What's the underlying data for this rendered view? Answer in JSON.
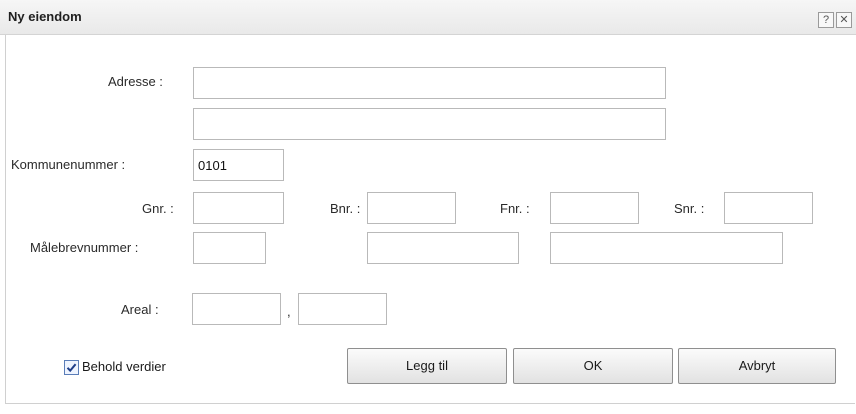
{
  "dialog": {
    "title": "Ny eiendom",
    "help_glyph": "?",
    "close_glyph": "✕"
  },
  "form": {
    "address_label": "Adresse :",
    "address_line1_value": "",
    "address_line2_value": "",
    "kommunenummer_label": "Kommunenummer :",
    "kommunenummer_value": "0101",
    "gnr_label": "Gnr. :",
    "gnr_value": "",
    "bnr_label": "Bnr. :",
    "bnr_value": "",
    "fnr_label": "Fnr. :",
    "fnr_value": "",
    "snr_label": "Snr. :",
    "snr_value": "",
    "malebrev_label": "Målebrevnummer :",
    "malebrev_value1": "",
    "malebrev_value2": "",
    "malebrev_value3": "",
    "areal_label": "Areal :",
    "areal_whole_value": "",
    "areal_separator": ",",
    "areal_fraction_value": ""
  },
  "footer": {
    "keep_values_label": "Behold verdier",
    "keep_values_checked": true,
    "add_label": "Legg til",
    "ok_label": "OK",
    "cancel_label": "Avbryt"
  },
  "colors": {
    "accent_checkbox": "#5a7db8",
    "field_border": "#b9b9b9"
  }
}
